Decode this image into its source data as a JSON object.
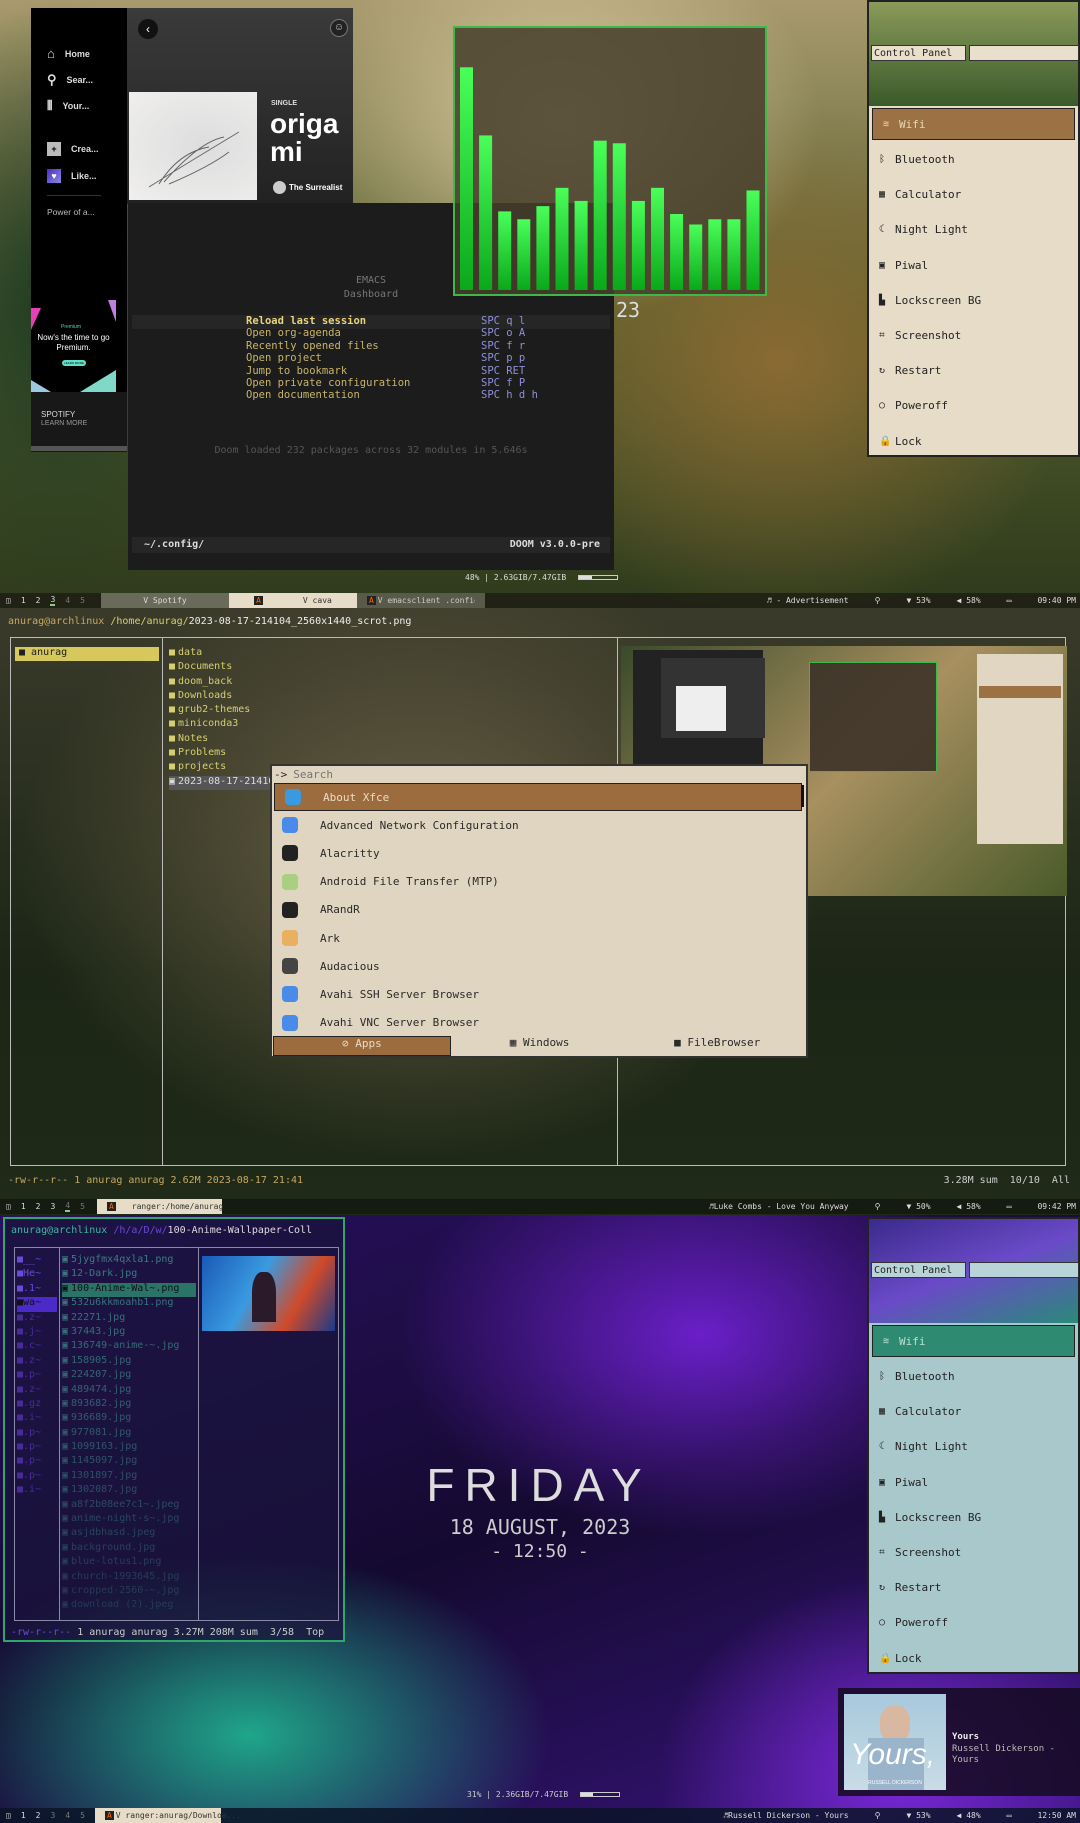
{
  "spotify": {
    "nav": [
      "Home",
      "Sear...",
      "Your..."
    ],
    "actions": [
      "Crea...",
      "Like..."
    ],
    "playlist": "Power of a...",
    "ad": {
      "brand": "Premium",
      "headline": "Now's the time to go Premium.",
      "cta": "LEARN MORE"
    },
    "footer_brand": "SPOTIFY",
    "footer_link": "LEARN MORE",
    "album": {
      "type": "SINGLE",
      "title_line1": "origa",
      "title_line2": "mi",
      "artist": "The Surrealist"
    }
  },
  "emacs": {
    "banner_line1": "EMACS",
    "banner_line2": "Dashboard",
    "menu": [
      {
        "label": "Reload last session",
        "key": "SPC q l"
      },
      {
        "label": "Open org-agenda",
        "key": "SPC o A"
      },
      {
        "label": "Recently opened files",
        "key": "SPC f r"
      },
      {
        "label": "Open project",
        "key": "SPC p p"
      },
      {
        "label": "Jump to bookmark",
        "key": "SPC RET"
      },
      {
        "label": "Open private configuration",
        "key": "SPC f P"
      },
      {
        "label": "Open documentation",
        "key": "SPC h d h"
      }
    ],
    "loaded": "Doom loaded 232 packages across 32 modules in 5.646s",
    "modeline_path": "~/.config/",
    "modeline_version": "DOOM v3.0.0-pre"
  },
  "cava": {
    "levels": [
      0.85,
      0.59,
      0.3,
      0.27,
      0.32,
      0.39,
      0.34,
      0.57,
      0.56,
      0.34,
      0.39,
      0.29,
      0.25,
      0.27,
      0.27,
      0.38
    ],
    "color": "#0fdc1e"
  },
  "desktop1": {
    "clock_fragment": "23",
    "memory": "48% | 2.63GIB/7.47GIB",
    "memory_fraction": 0.35
  },
  "control_panel": {
    "title": "Control Panel",
    "items": [
      {
        "icon": "wifi-icon",
        "glyph": "≋",
        "label": "Wifi"
      },
      {
        "icon": "bluetooth-icon",
        "glyph": "ᛒ",
        "label": "Bluetooth"
      },
      {
        "icon": "calculator-icon",
        "glyph": "▦",
        "label": "Calculator"
      },
      {
        "icon": "night-light-icon",
        "glyph": "☾",
        "label": "Night Light"
      },
      {
        "icon": "piwal-icon",
        "glyph": "▣",
        "label": "Piwal"
      },
      {
        "icon": "lockscreen-icon",
        "glyph": "▙",
        "label": "Lockscreen BG"
      },
      {
        "icon": "screenshot-icon",
        "glyph": "⌗",
        "label": "Screenshot"
      },
      {
        "icon": "restart-icon",
        "glyph": "↻",
        "label": "Restart"
      },
      {
        "icon": "power-icon",
        "glyph": "○",
        "label": "Poweroff"
      },
      {
        "icon": "lock-icon",
        "glyph": "🔒",
        "label": "Lock"
      }
    ],
    "accent_forest": "#9c7244",
    "accent_purple": "#2e8a70"
  },
  "bar1": {
    "workspaces": [
      "1",
      "2",
      "3",
      "4",
      "5"
    ],
    "tabs": [
      "V Spotify",
      "V cava",
      "V emacsclient .config/q..."
    ],
    "media": "♬ - Advertisement",
    "wifi": "53%",
    "volume": "58%",
    "time": "09:40 PM"
  },
  "ranger1": {
    "user": "anurag@archlinux",
    "dir": "/home/anurag/",
    "file": "2023-08-17-214104_2560x1440_scrot.png",
    "parent": [
      "anurag"
    ],
    "entries": [
      "data",
      "Documents",
      "doom_back",
      "Downloads",
      "grub2-themes",
      "miniconda3",
      "Notes",
      "Problems",
      "projects",
      "2023-08-17-214104_2560x1440_scrot.png"
    ],
    "status_left": "-rw-r--r-- 1 anurag anurag 2.62M 2023-08-17 21:41",
    "status_right": "3.28M sum  10/10  All"
  },
  "rofi": {
    "prompt": "->",
    "placeholder": "Search",
    "items": [
      "About Xfce",
      "Advanced Network Configuration",
      "Alacritty",
      "Android File Transfer (MTP)",
      "ARandR",
      "Ark",
      "Audacious",
      "Avahi SSH Server Browser",
      "Avahi VNC Server Browser"
    ],
    "modes": [
      "Apps",
      "Windows",
      "FileBrowser"
    ]
  },
  "bar2": {
    "workspaces": [
      "1",
      "2",
      "3",
      "4",
      "5"
    ],
    "tab": "ranger:/home/anurag",
    "media": "♬Luke Combs - Love You Anyway",
    "wifi": "50%",
    "volume": "58%",
    "time": "09:42 PM"
  },
  "ranger2": {
    "user": "anurag@archlinux",
    "dir": "/h/a/D/w/",
    "current": "100-Anime-Wallpaper-Coll",
    "parent": [
      "__~",
      "He~",
      ".1~",
      "wa~",
      ".z~",
      ".j~",
      ".c~",
      ".z~",
      ".p~",
      ".z~",
      ".gz",
      ".i~",
      ".p~",
      ".p~",
      ".p~",
      ".p~",
      ".i~"
    ],
    "files": [
      "5jygfmx4qxla1.png",
      "12-Dark.jpg",
      "100-Anime-Wal~.png",
      "532u6kkmoahb1.png",
      "22271.jpg",
      "37443.jpg",
      "136749-anime-~.jpg",
      "158905.jpg",
      "224207.jpg",
      "489474.jpg",
      "893682.jpg",
      "936689.jpg",
      "977081.jpg",
      "1099163.jpg",
      "1145097.jpg",
      "1301897.jpg",
      "1302087.jpg",
      "a8f2b08ee7c1~.jpeg",
      "anime-night-s~.jpg",
      "asjdbhasd.jpeg",
      "background.jpg",
      "blue-lotus1.png",
      "church-1993645.jpg",
      "cropped-2560-~.jpg",
      "download (2).jpeg"
    ],
    "status_left": "-rw-r--r--",
    "status_mid": "1 anurag anurag 3.27M 208M sum",
    "status_pos": "3/58",
    "status_scroll": "Top"
  },
  "clock": {
    "day": "FRIDAY",
    "date": "18 AUGUST, 2023",
    "time": "- 12:50 -"
  },
  "music": {
    "cover_text": "Yours,",
    "cover_artist": "RUSSELL DICKERSON",
    "title": "Yours",
    "artist_line": "Russell Dickerson -",
    "album_line": "Yours"
  },
  "desktop3": {
    "memory": "31% | 2.36GIB/7.47GIB",
    "memory_fraction": 0.31
  },
  "bar3": {
    "workspaces": [
      "1",
      "2",
      "3",
      "4",
      "5"
    ],
    "tab": "V ranger:anurag/Downloa...",
    "media": "♬Russell Dickerson - Yours",
    "wifi": "53%",
    "volume": "48%",
    "time": "12:50 AM"
  }
}
